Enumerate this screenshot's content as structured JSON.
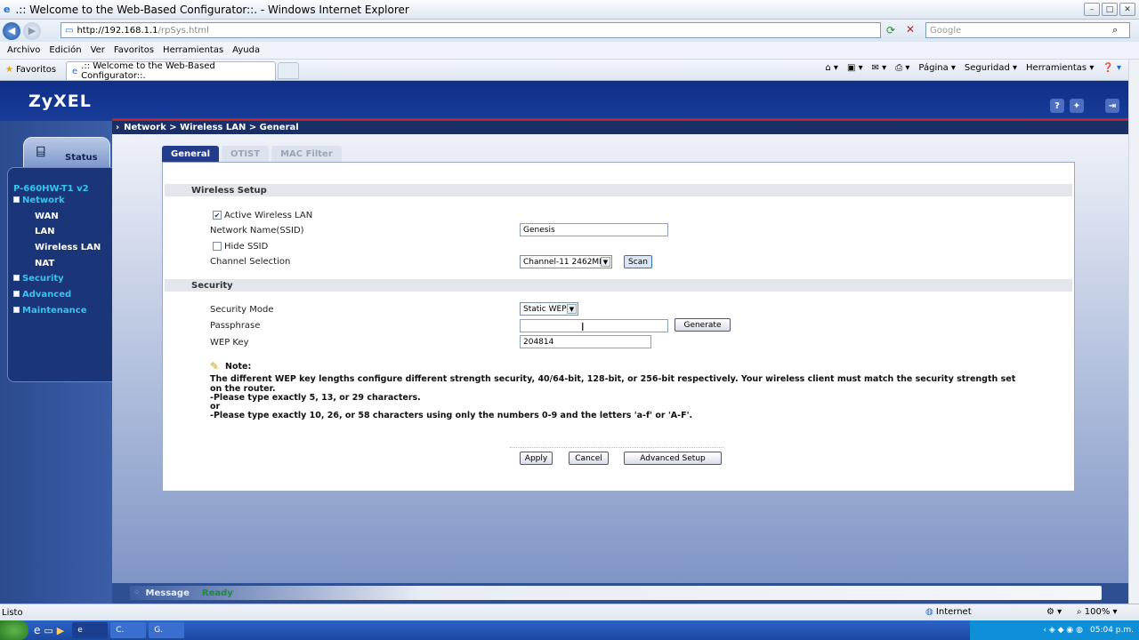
{
  "window": {
    "title": ".:: Welcome to the Web-Based Configurator::. - Windows Internet Explorer"
  },
  "address": {
    "host": "http://192.168.1.1",
    "path": "/rpSys.html"
  },
  "search": {
    "placeholder": "Google"
  },
  "menu": [
    "Archivo",
    "Edición",
    "Ver",
    "Favoritos",
    "Herramientas",
    "Ayuda"
  ],
  "favbar": {
    "favorites": "Favoritos",
    "tab": ".:: Welcome to the Web-Based Configurator::.",
    "commands": [
      "Página",
      "Seguridad",
      "Herramientas"
    ]
  },
  "page": {
    "logo": "ZyXEL",
    "breadcrumb": "Network > Wireless LAN > General",
    "status_tab": "Status",
    "model": "P-660HW-T1 v2",
    "nav": {
      "network": "Network",
      "items": [
        "WAN",
        "LAN",
        "Wireless LAN",
        "NAT"
      ],
      "security": "Security",
      "advanced": "Advanced",
      "maintenance": "Maintenance"
    },
    "tabs": [
      "General",
      "OTIST",
      "MAC Filter"
    ],
    "wireless_setup": {
      "title": "Wireless Setup",
      "active_label": "Active Wireless LAN",
      "active_checked": true,
      "ssid_label": "Network Name(SSID)",
      "ssid_value": "Genesis",
      "hide_ssid_label": "Hide SSID",
      "hide_ssid_checked": false,
      "channel_label": "Channel Selection",
      "channel_value": "Channel-11 2462MHz",
      "scan_button": "Scan"
    },
    "security": {
      "title": "Security",
      "mode_label": "Security Mode",
      "mode_value": "Static WEP",
      "passphrase_label": "Passphrase",
      "passphrase_value": "",
      "generate_button": "Generate",
      "wep_label": "WEP Key",
      "wep_value": "204814"
    },
    "note": {
      "title": "Note:",
      "line1": "The different WEP key lengths configure different strength security, 40/64-bit, 128-bit, or 256-bit respectively. Your wireless client must match the security strength set on the router.",
      "line2": "-Please type exactly 5, 13, or 29 characters.",
      "or": "or",
      "line3": "-Please type exactly 10, 26, or 58 characters using only the numbers 0-9 and the letters 'a-f' or 'A-F'."
    },
    "buttons": {
      "apply": "Apply",
      "cancel": "Cancel",
      "advanced": "Advanced Setup"
    },
    "message": {
      "label": "Message",
      "value": "Ready"
    }
  },
  "statusbar": {
    "left": "Listo",
    "zone": "Internet",
    "zoom": "100%"
  },
  "taskbar": {
    "items": [
      "C.",
      "G."
    ],
    "clock": "05:04 p.m."
  }
}
